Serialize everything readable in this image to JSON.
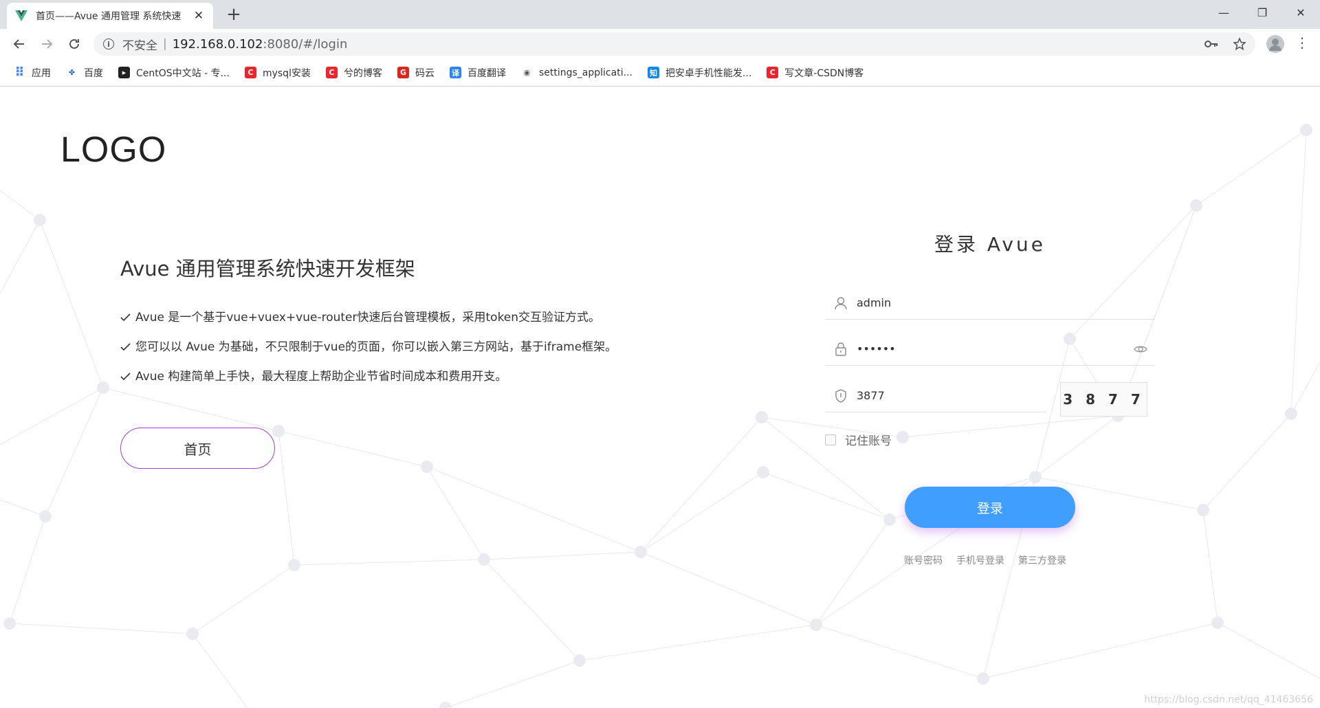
{
  "browser": {
    "tab_title": "首页——Avue 通用管理 系统快速",
    "tab_close": "✕",
    "new_tab": "+",
    "insecure_label": "不安全",
    "separator": "|",
    "url_host": "192.168.0.102",
    "url_path": ":8080/#/login",
    "window_controls": [
      "—",
      "❐",
      "✕"
    ]
  },
  "bookmarks": [
    {
      "label": "应用",
      "icon": "apps-grid-icon",
      "color": "#4285f4"
    },
    {
      "label": "百度",
      "icon": "baidu-paw-icon",
      "color": "#2b65e0"
    },
    {
      "label": "CentOS中文站 - 专...",
      "icon": "terminal-icon",
      "color": "#222222"
    },
    {
      "label": "mysql安装",
      "icon": "csdn-icon",
      "color": "#e8262c"
    },
    {
      "label": "兮的博客",
      "icon": "csdn-icon",
      "color": "#e8262c"
    },
    {
      "label": "码云",
      "icon": "gitee-icon",
      "color": "#d9271e"
    },
    {
      "label": "百度翻译",
      "icon": "translate-icon",
      "color": "#2c83f6"
    },
    {
      "label": "settings_applicati...",
      "icon": "globe-icon",
      "color": "#555555"
    },
    {
      "label": "把安卓手机性能发...",
      "icon": "zhihu-icon",
      "color": "#0f88eb"
    },
    {
      "label": "写文章-CSDN博客",
      "icon": "csdn-icon",
      "color": "#e8262c"
    }
  ],
  "page": {
    "logo": "LOGO",
    "intro_title": "Avue 通用管理系统快速开发框架",
    "intro_items": [
      "Avue 是一个基于vue+vuex+vue-router快速后台管理模板，采用token交互验证方式。",
      "您可以以 Avue 为基础，不只限制于vue的页面，你可以嵌入第三方网站，基于iframe框架。",
      "Avue 构建简单上手快，最大程度上帮助企业节省时间成本和费用开支。"
    ],
    "home_button": "首页"
  },
  "login": {
    "title": "登录 Avue",
    "username": "admin",
    "password": "••••••",
    "captcha_value": "3877",
    "captcha_image_text": "3 8 7 7",
    "remember_label": "记住账号",
    "submit_label": "登录",
    "links": [
      "账号密码",
      "手机号登录",
      "第三方登录"
    ]
  },
  "watermark": "https://blog.csdn.net/qq_41463656",
  "colors": {
    "primary": "#409eff",
    "home_border": "#a23cd7"
  }
}
